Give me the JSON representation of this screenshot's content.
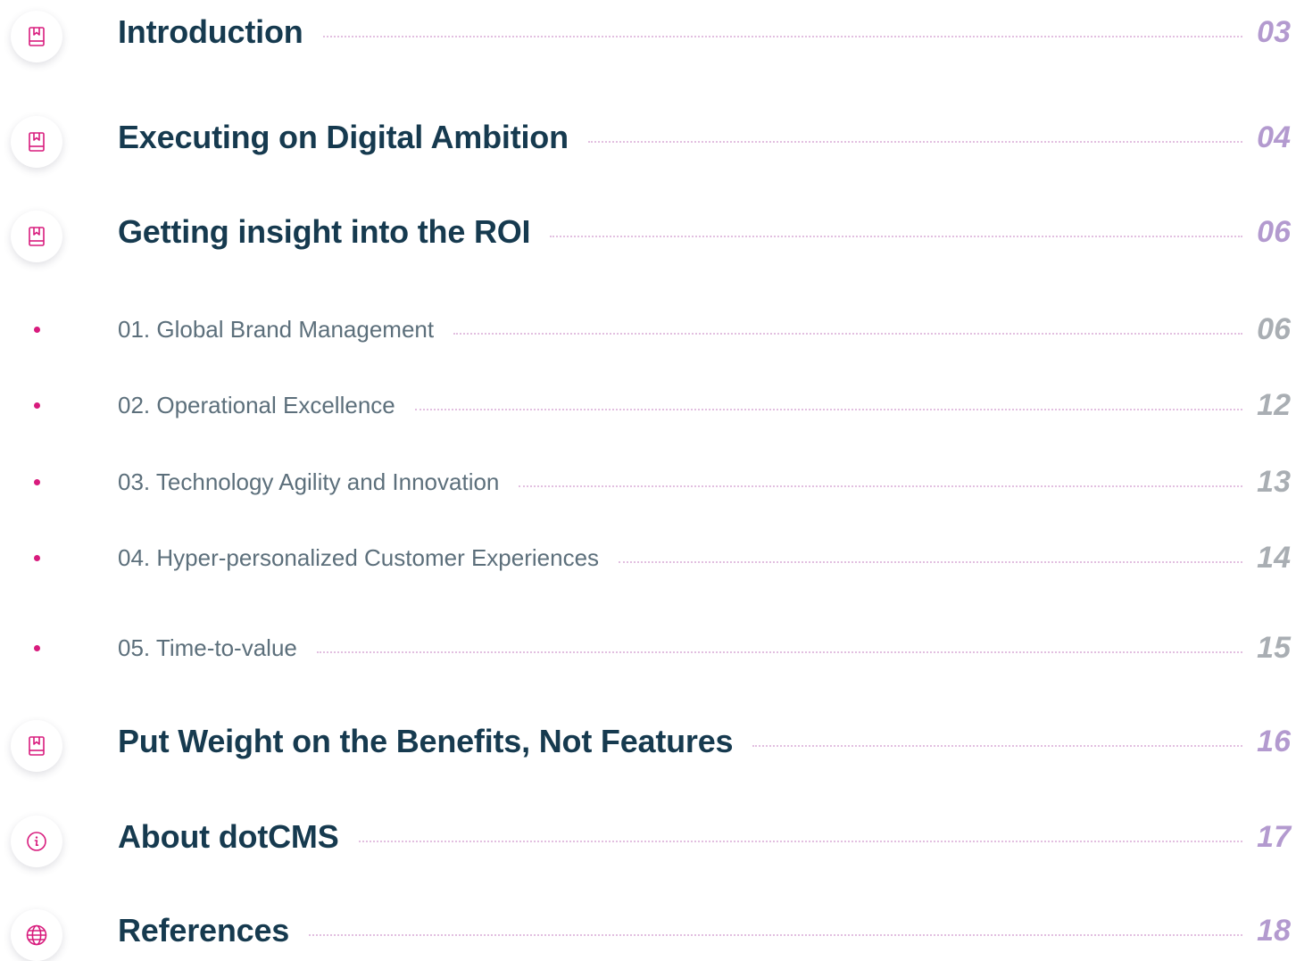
{
  "toc": {
    "entries": [
      {
        "kind": "main",
        "icon": "book-icon",
        "title": "Introduction",
        "page": "03"
      },
      {
        "kind": "main",
        "icon": "book-icon",
        "title": "Executing on Digital Ambition",
        "page": "04"
      },
      {
        "kind": "main",
        "icon": "book-icon",
        "title": "Getting insight into the ROI",
        "page": "06"
      },
      {
        "kind": "sub",
        "icon": "bullet-dot",
        "title": "01. Global Brand Management",
        "page": "06"
      },
      {
        "kind": "sub",
        "icon": "bullet-dot",
        "title": "02. Operational Excellence",
        "page": "12"
      },
      {
        "kind": "sub",
        "icon": "bullet-dot",
        "title": "03. Technology Agility and Innovation",
        "page": "13"
      },
      {
        "kind": "sub",
        "icon": "bullet-dot",
        "title": "04. Hyper-personalized Customer Experiences",
        "page": "14"
      },
      {
        "kind": "sub",
        "icon": "bullet-dot",
        "title": "05. Time-to-value",
        "page": "15"
      },
      {
        "kind": "main",
        "icon": "book-icon",
        "title": "Put Weight on the Benefits, Not Features",
        "page": "16"
      },
      {
        "kind": "main",
        "icon": "info-icon",
        "title": "About dotCMS",
        "page": "17"
      },
      {
        "kind": "main",
        "icon": "globe-icon",
        "title": "References",
        "page": "18"
      }
    ]
  },
  "colors": {
    "heading": "#163a4f",
    "subheading": "#5c6f7b",
    "main_page_number": "#b39acf",
    "sub_page_number": "#a9aeb3",
    "accent_icon": "#d81b7d",
    "leader_dots": "#e2bfe0"
  }
}
